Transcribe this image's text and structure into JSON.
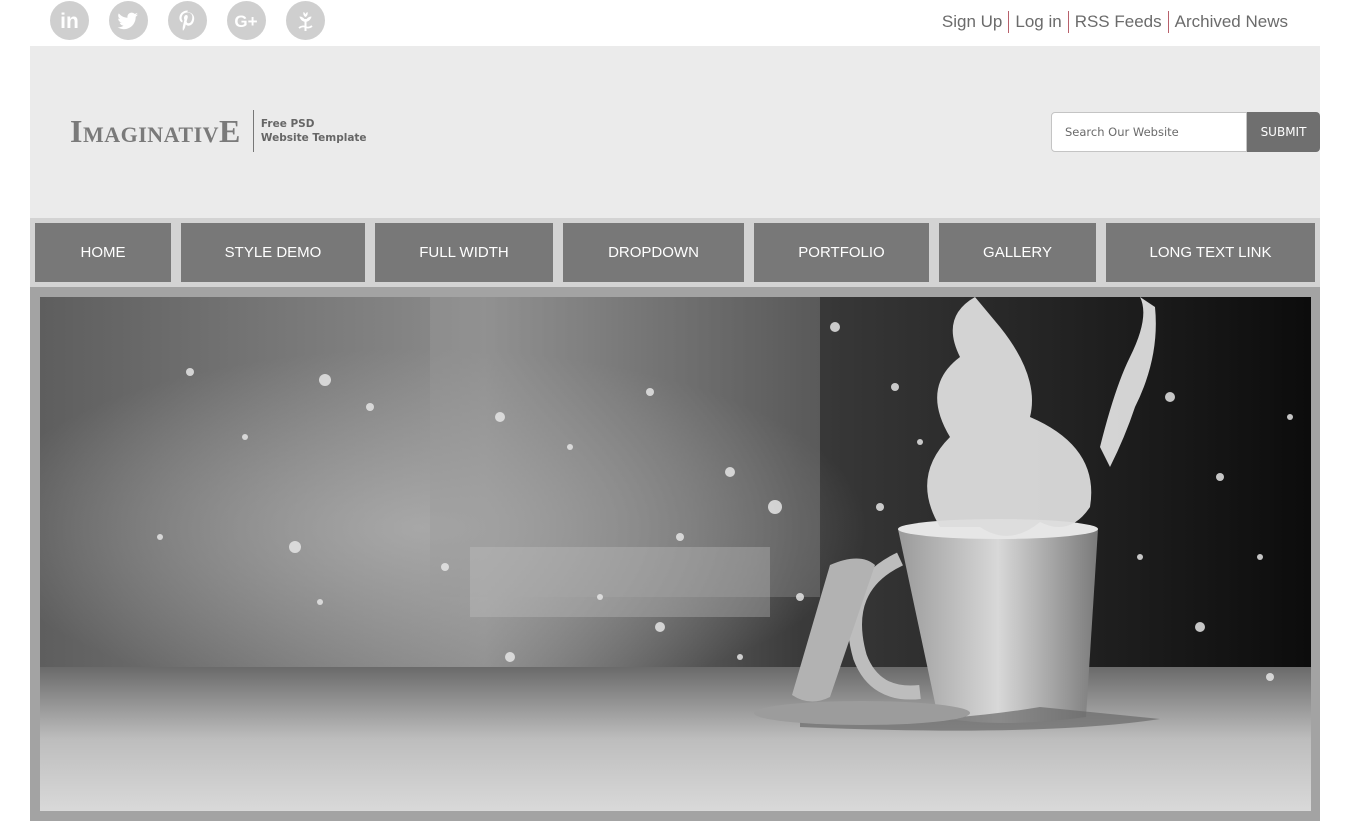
{
  "social": {
    "icons": [
      "linkedin-icon",
      "twitter-icon",
      "pinterest-icon",
      "google-plus-icon",
      "leaf-icon"
    ],
    "linkedin_text": "in",
    "googleplus_text": "G+"
  },
  "toplinks": [
    "Sign Up",
    "Log in",
    "RSS Feeds",
    "Archived News"
  ],
  "logo": {
    "first_letter": "I",
    "middle": "MAGINATIV",
    "last_letter": "E",
    "tagline_line1": "Free PSD",
    "tagline_line2": "Website Template"
  },
  "search": {
    "placeholder": "Search Our Website",
    "submit_label": "SUBMIT"
  },
  "nav": [
    "HOME",
    "STYLE DEMO",
    "FULL WIDTH",
    "DROPDOWN",
    "PORTFOLIO",
    "GALLERY",
    "LONG TEXT LINK"
  ],
  "colors": {
    "header_bg": "#ebebeb",
    "nav_bg": "#d3d3d3",
    "nav_item": "#787878",
    "submit_bg": "#6f6f6f",
    "link_separator": "#b8606b"
  }
}
